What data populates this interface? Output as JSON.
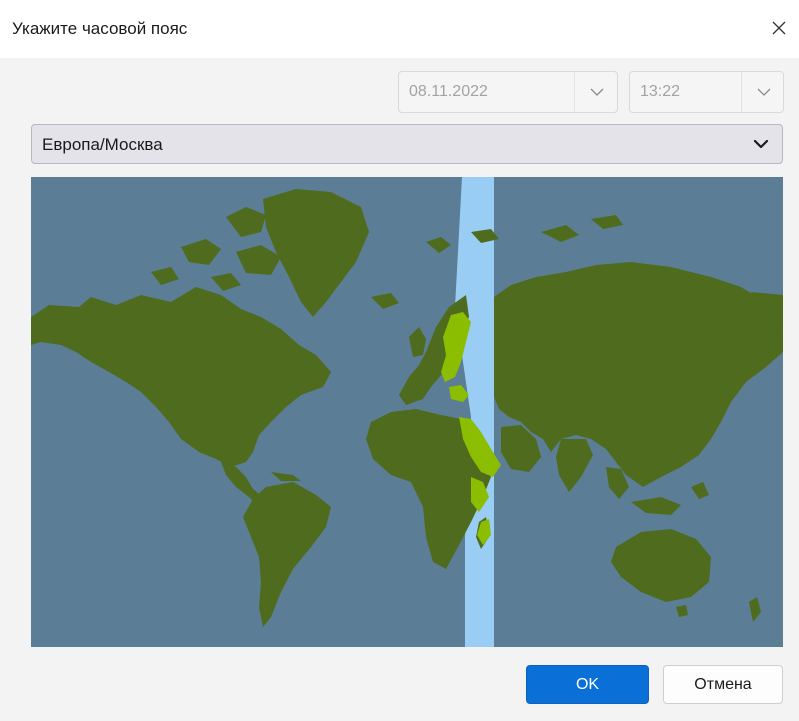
{
  "dialog": {
    "title": "Укажите часовой пояс",
    "close_icon": "close-icon"
  },
  "date": {
    "value": "08.11.2022",
    "icon": "chevron-down-icon"
  },
  "time": {
    "value": "13:22",
    "icon": "chevron-down-icon"
  },
  "timezone": {
    "selected": "Европа/Москва",
    "icon": "chevron-down-icon"
  },
  "map": {
    "ocean_color": "#5b7e96",
    "land_color": "#4e6b1e",
    "highlight_zone_color": "#99cdf3",
    "highlight_land_color": "#8bbd00"
  },
  "buttons": {
    "ok": "OK",
    "cancel": "Отмена"
  },
  "colors": {
    "accent": "#0a6fd6"
  }
}
